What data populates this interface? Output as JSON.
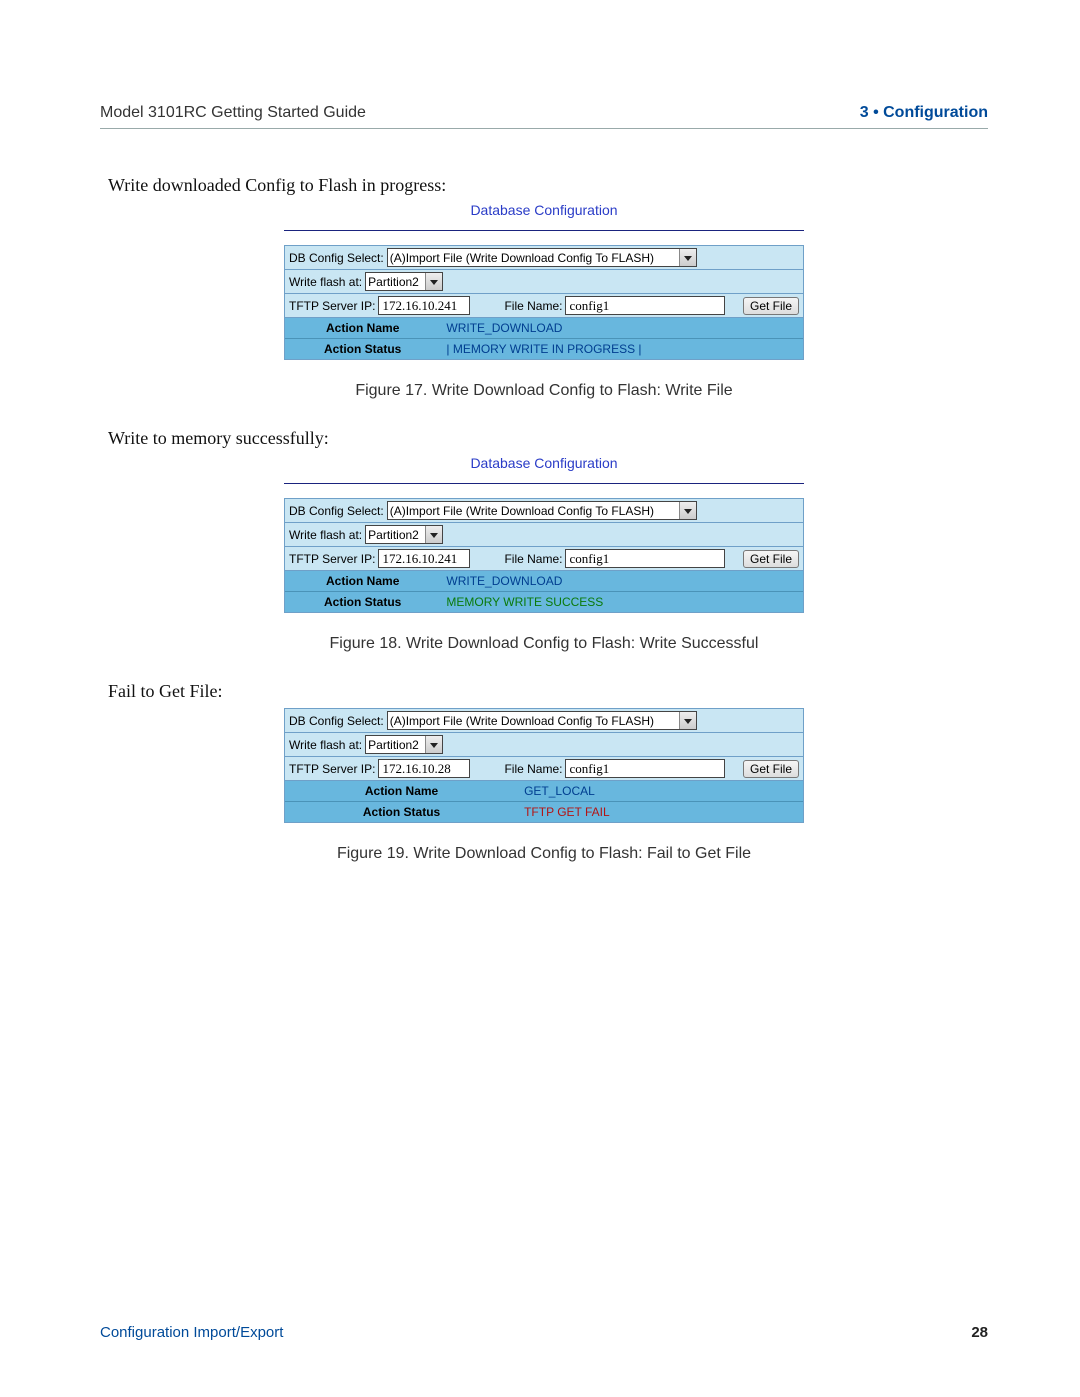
{
  "header": {
    "left": "Model 3101RC Getting Started Guide",
    "right": "3 • Configuration"
  },
  "sections": [
    {
      "intro": "Write downloaded Config to Flash in progress:",
      "show_title": true,
      "panel_title": "Database Configuration",
      "labels": {
        "db_select": "DB Config Select:",
        "write_flash": "Write flash at:",
        "tftp_ip": "TFTP Server IP:",
        "file_name": "File Name:",
        "get_file": "Get File",
        "action_name": "Action Name",
        "action_status": "Action Status"
      },
      "values": {
        "db_select": "(A)Import File (Write Download Config To FLASH)",
        "write_flash": "Partition2",
        "tftp_ip": "172.16.10.241",
        "file_name": "config1",
        "action_name": "WRITE_DOWNLOAD",
        "action_status": "| MEMORY WRITE IN PROGRESS |",
        "status_class": ""
      },
      "kv_k_width": "30%",
      "caption": "Figure 17. Write Download Config to Flash: Write File"
    },
    {
      "intro": "Write to memory successfully:",
      "show_title": true,
      "panel_title": "Database Configuration",
      "labels": {
        "db_select": "DB Config Select:",
        "write_flash": "Write flash at:",
        "tftp_ip": "TFTP Server IP:",
        "file_name": "File Name:",
        "get_file": "Get File",
        "action_name": "Action Name",
        "action_status": "Action Status"
      },
      "values": {
        "db_select": "(A)Import File (Write Download Config To FLASH)",
        "write_flash": "Partition2",
        "tftp_ip": "172.16.10.241",
        "file_name": "config1",
        "action_name": "WRITE_DOWNLOAD",
        "action_status": "MEMORY WRITE SUCCESS",
        "status_class": "green"
      },
      "kv_k_width": "30%",
      "caption": "Figure 18. Write Download Config to Flash: Write Successful"
    },
    {
      "intro": "Fail to Get File:",
      "show_title": false,
      "panel_title": "",
      "labels": {
        "db_select": "DB Config Select:",
        "write_flash": "Write flash at:",
        "tftp_ip": "TFTP Server IP:",
        "file_name": "File Name:",
        "get_file": "Get File",
        "action_name": "Action Name",
        "action_status": "Action Status"
      },
      "values": {
        "db_select": "(A)Import File (Write Download Config To FLASH)",
        "write_flash": "Partition2",
        "tftp_ip": "172.16.10.28",
        "file_name": "config1",
        "action_name": "GET_LOCAL",
        "action_status": "TFTP GET FAIL",
        "status_class": "red"
      },
      "kv_k_width": "45%",
      "caption": "Figure 19. Write Download Config to Flash: Fail to Get File"
    }
  ],
  "footer": {
    "left": "Configuration Import/Export",
    "right": "28"
  }
}
